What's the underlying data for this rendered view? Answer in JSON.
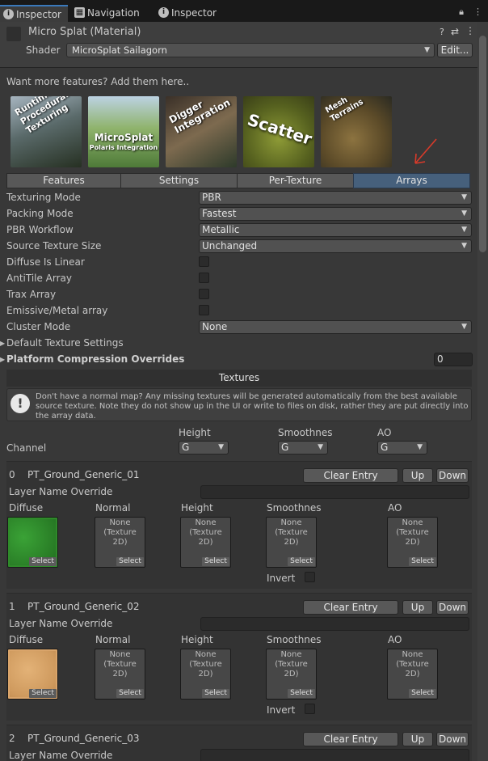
{
  "tabs": [
    {
      "label": "Inspector",
      "active": true
    },
    {
      "label": "Navigation",
      "active": false
    },
    {
      "label": "Inspector",
      "active": false
    }
  ],
  "header": {
    "title": "Micro Splat (Material)",
    "shader_label": "Shader",
    "shader_value": "MicroSplat Sailagorn",
    "edit_label": "Edit..."
  },
  "features_text": "Want more features? Add them here..",
  "banners": [
    {
      "text": "Runtime Procedural Texturing"
    },
    {
      "text": "MicroSplat",
      "sub": "Polaris Integration"
    },
    {
      "text": "Digger Integration"
    },
    {
      "text": "Scatter"
    },
    {
      "text": "Mesh Terrains"
    }
  ],
  "toolbar": [
    "Features",
    "Settings",
    "Per-Texture",
    "Arrays"
  ],
  "properties": [
    {
      "label": "Texturing Mode",
      "value": "PBR",
      "kind": "dropdown"
    },
    {
      "label": "Packing Mode",
      "value": "Fastest",
      "kind": "dropdown"
    },
    {
      "label": "PBR Workflow",
      "value": "Metallic",
      "kind": "dropdown"
    },
    {
      "label": "Source Texture Size",
      "value": "Unchanged",
      "kind": "dropdown"
    },
    {
      "label": "Diffuse Is Linear",
      "kind": "checkbox"
    },
    {
      "label": "AntiTile Array",
      "kind": "checkbox"
    },
    {
      "label": "Trax Array",
      "kind": "checkbox"
    },
    {
      "label": "Emissive/Metal array",
      "kind": "checkbox"
    },
    {
      "label": "Cluster Mode",
      "value": "None",
      "kind": "dropdown"
    }
  ],
  "foldouts": {
    "default_texture_settings": "Default Texture Settings",
    "platform_overrides": "Platform Compression Overrides",
    "platform_count": "0"
  },
  "textures_section": "Textures",
  "help_text": "Don't have a normal map? Any missing textures will be generated automatically from the best available source texture. Note they do not show up in the UI or write to files on disk, rather they are put directly into the array data.",
  "channel": {
    "label": "Channel",
    "columns": [
      {
        "label": "Height",
        "value": "G"
      },
      {
        "label": "Smoothnes",
        "value": "G"
      },
      {
        "label": "AO",
        "value": "G"
      }
    ]
  },
  "entry_labels": {
    "clear": "Clear Entry",
    "up": "Up",
    "down": "Down",
    "layer_override": "Layer Name Override",
    "diffuse": "Diffuse",
    "normal": "Normal",
    "height": "Height",
    "smoothness": "Smoothnes",
    "ao": "AO",
    "invert": "Invert",
    "none": "None",
    "texture2d": "(Texture 2D)",
    "select": "Select"
  },
  "entries": [
    {
      "index": "0",
      "name": "PT_Ground_Generic_01",
      "diffuse_color": "#2f8a2a"
    },
    {
      "index": "1",
      "name": "PT_Ground_Generic_02",
      "diffuse_color": "#d9a46a"
    },
    {
      "index": "2",
      "name": "PT_Ground_Generic_03"
    }
  ],
  "colors": {
    "active_tab_accent": "#3a79bb",
    "selected_toolbar": "#46607c",
    "annotation_arrow": "#d83a2a"
  }
}
